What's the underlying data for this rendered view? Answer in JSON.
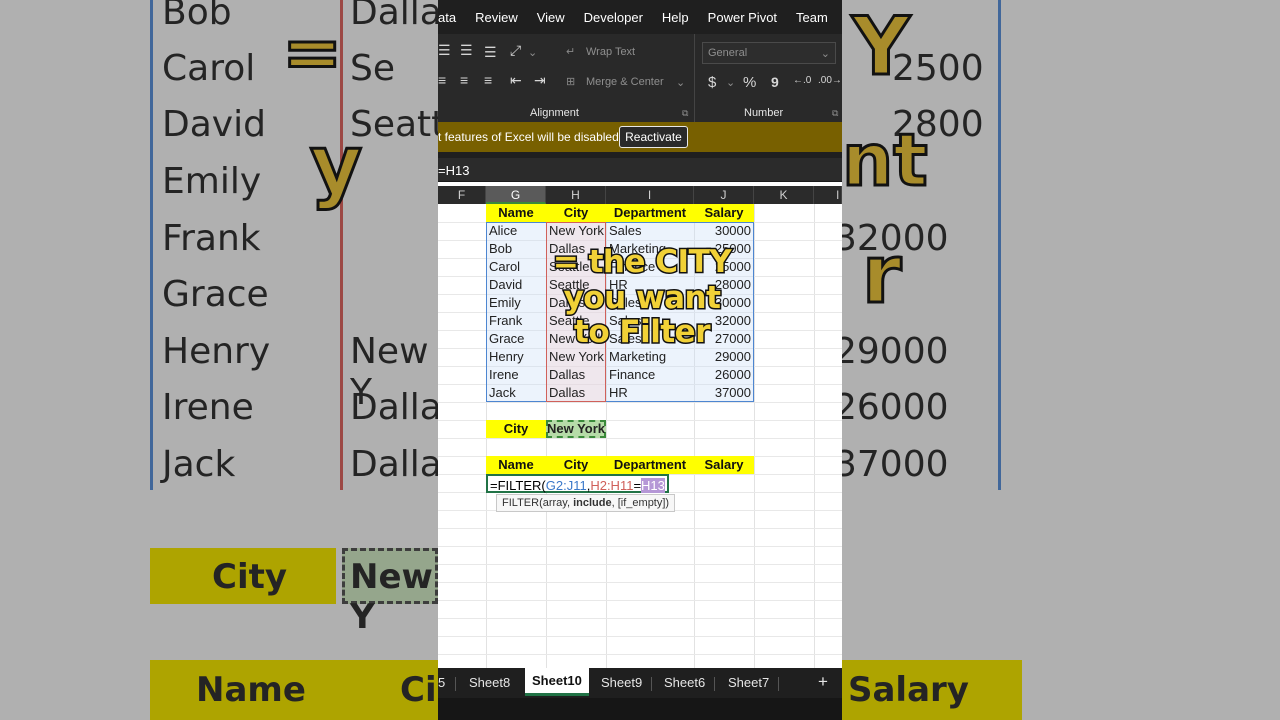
{
  "menu": [
    "ata",
    "Review",
    "View",
    "Developer",
    "Help",
    "Power Pivot",
    "Team"
  ],
  "ribbon": {
    "wrap_text": "Wrap Text",
    "merge_center": "Merge & Center",
    "alignment_label": "Alignment",
    "number_format": "General",
    "number_label": "Number",
    "currency_symbol": "$",
    "percent_symbol": "%",
    "comma_symbol": "9"
  },
  "warning": {
    "message": "t features of Excel will be disabled.",
    "button": "Reactivate"
  },
  "formula_bar": "=H13",
  "columns": [
    "F",
    "G",
    "H",
    "I",
    "J",
    "K",
    "L"
  ],
  "table": {
    "headers": [
      "Name",
      "City",
      "Department",
      "Salary"
    ],
    "rows": [
      [
        "Alice",
        "New York",
        "Sales",
        "30000"
      ],
      [
        "Bob",
        "Dallas",
        "Marketing",
        "25000"
      ],
      [
        "Carol",
        "Seattle",
        "Finance",
        "25000"
      ],
      [
        "David",
        "Seattle",
        "HR",
        "28000"
      ],
      [
        "Emily",
        "Dallas",
        "Sales",
        "30000"
      ],
      [
        "Frank",
        "Seattle",
        "Sales",
        "32000"
      ],
      [
        "Grace",
        "New York",
        "Sales",
        "27000"
      ],
      [
        "Henry",
        "New York",
        "Marketing",
        "29000"
      ],
      [
        "Irene",
        "Dallas",
        "Finance",
        "26000"
      ],
      [
        "Jack",
        "Dallas",
        "HR",
        "37000"
      ]
    ]
  },
  "criteria": {
    "label": "City",
    "value": "New York"
  },
  "output_headers": [
    "Name",
    "City",
    "Department",
    "Salary"
  ],
  "formula": {
    "prefix": "=FILTER(",
    "array": "G2:J11",
    "comma": ",",
    "include": "H2:H11",
    "equals": "=",
    "criteria": "H13"
  },
  "tooltip": {
    "start": "FILTER(array, ",
    "bold": "include",
    "end": ", [if_empty])"
  },
  "overlay_caption": [
    "= the CITY",
    "you want",
    "to Filter"
  ],
  "sheets": [
    "5",
    "Sheet8",
    "Sheet10",
    "Sheet9",
    "Sheet6",
    "Sheet7"
  ],
  "add_sheet": "+",
  "background": {
    "left_names": [
      "Bob",
      "Carol",
      "David",
      "Emily",
      "Frank",
      "Grace",
      "Henry",
      "Irene",
      "Jack"
    ],
    "left_cities": [
      "Dalla",
      "Se",
      "Seattl",
      "",
      "",
      "N",
      "New Y",
      "Dalla",
      "Dalla"
    ],
    "right_values": [
      "",
      "2500",
      "2800",
      "",
      "32000",
      "",
      "29000",
      "26000",
      "37000"
    ],
    "city_label": "City",
    "city_value": "New Y",
    "name_label": "Name",
    "ci_label": "Ci",
    "salary_label": "Salary"
  }
}
